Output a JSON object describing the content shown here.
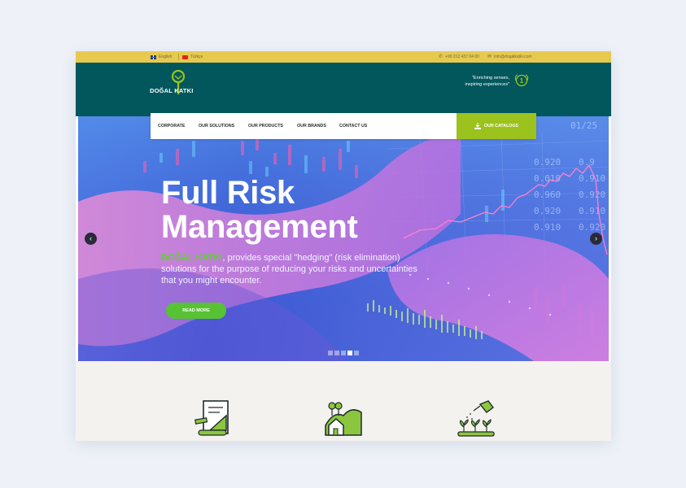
{
  "topbar": {
    "lang_en": "English",
    "lang_tr": "Türkçe",
    "phone": "+90 212 437 04 00",
    "email": "info@dogalkatki.com"
  },
  "header": {
    "logo_text": "DOĞAL KATKI",
    "tagline_line1": "\"Enriching senses,",
    "tagline_line2": "inspiring experiences\""
  },
  "nav": {
    "items": [
      "CORPORATE",
      "OUR SOLUTIONS",
      "OUR PRODUCTS",
      "OUR BRANDS",
      "CONTACT US"
    ],
    "catalog": "OUR CATALOGS"
  },
  "hero": {
    "title_line1": "Full Risk",
    "title_line2": "Management",
    "brand": "DOĞAL KATKI",
    "desc": ", provides special \"hedging\" (risk elimination) solutions for the purpose of reducing your risks and uncertainties that you might encounter.",
    "button": "READ MORE",
    "slides": 5,
    "active_slide": 4
  },
  "icons": {
    "phone": "phone-icon",
    "email": "envelope-icon",
    "download": "download-icon",
    "prev": "chevron-left-icon",
    "next": "chevron-right-icon",
    "features": [
      "document-ruler-icon",
      "house-hills-icon",
      "watering-plants-icon"
    ]
  },
  "colors": {
    "topbar": "#e8c94f",
    "header": "#02575c",
    "accent_green": "#9cc21d",
    "button_green": "#57c234",
    "features_bg": "#f4f2ef"
  }
}
